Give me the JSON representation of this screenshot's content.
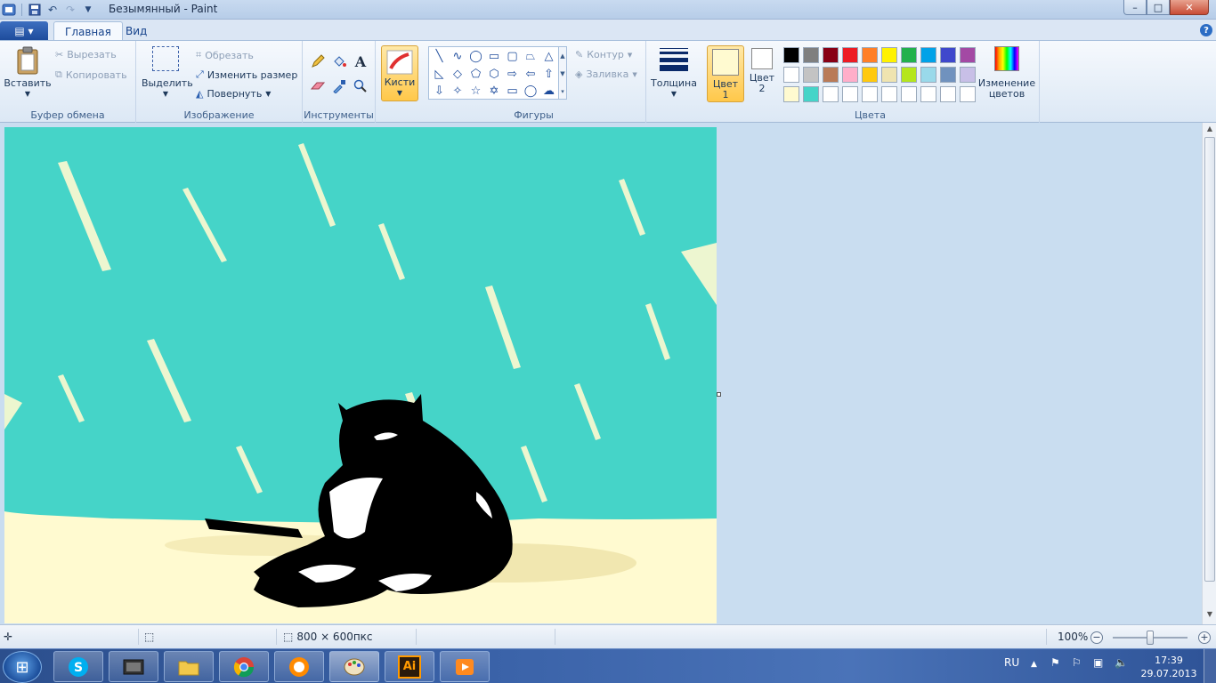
{
  "window": {
    "title": "Безымянный - Paint",
    "controls": {
      "minimize": "–",
      "maximize": "□",
      "close": "✕"
    }
  },
  "tabs": {
    "home": "Главная",
    "view": "Вид"
  },
  "clipboard": {
    "paste": "Вставить",
    "cut": "Вырезать",
    "copy": "Копировать",
    "label": "Буфер обмена"
  },
  "image": {
    "select": "Выделить",
    "crop": "Обрезать",
    "resize": "Изменить размер",
    "rotate": "Повернуть",
    "label": "Изображение"
  },
  "tools": {
    "label": "Инструменты",
    "items": [
      "pencil-icon",
      "fill-icon",
      "text-icon",
      "eraser-icon",
      "color-picker-icon",
      "magnifier-icon"
    ]
  },
  "brushes": {
    "label": "Кисти"
  },
  "shapes": {
    "label": "Фигуры",
    "outline": "Контур",
    "fill": "Заливка",
    "glyphs": [
      "╲",
      "∿",
      "◯",
      "▭",
      "▢",
      "⏢",
      "△",
      "◺",
      "◇",
      "⬠",
      "⬡",
      "⇨",
      "⇦",
      "⇧",
      "⇩",
      "✧",
      "☆",
      "✡",
      "▭",
      "◯",
      "☁"
    ]
  },
  "size": {
    "label": "Толщина"
  },
  "colors": {
    "color1": "Цвет 1",
    "color2": "Цвет 2",
    "edit": "Изменение цветов",
    "label": "Цвета",
    "color1_value": "#fffad0",
    "color2_value": "#ffffff",
    "palette": [
      "#000000",
      "#7f7f7f",
      "#880015",
      "#ed1c24",
      "#ff7f27",
      "#fff200",
      "#22b14c",
      "#00a2e8",
      "#3f48cc",
      "#a349a4",
      "#ffffff",
      "#c3c3c3",
      "#b97a57",
      "#ffaec9",
      "#ffc90e",
      "#efe4b0",
      "#b5e61d",
      "#99d9ea",
      "#7092be",
      "#c8bfe7",
      "#fffad0",
      "#45d4c8",
      "#ffffff",
      "#ffffff",
      "#ffffff",
      "#ffffff",
      "#ffffff",
      "#ffffff",
      "#ffffff",
      "#ffffff"
    ]
  },
  "canvas": {
    "background": "#fffad0",
    "sky": "#45d4c8",
    "cat": "#000000"
  },
  "status": {
    "dimensions": "800 × 600пкс",
    "zoom": "100%",
    "zoom_minus": "−",
    "zoom_plus": "+"
  },
  "taskbar": {
    "apps": [
      "skype-icon",
      "media-player-icon",
      "explorer-icon",
      "chrome-icon",
      "orb-icon",
      "paint-icon",
      "illustrator-icon",
      "video-icon"
    ],
    "illustrator_label": "Ai",
    "lang": "RU",
    "time": "17:39",
    "date": "29.07.2013"
  }
}
